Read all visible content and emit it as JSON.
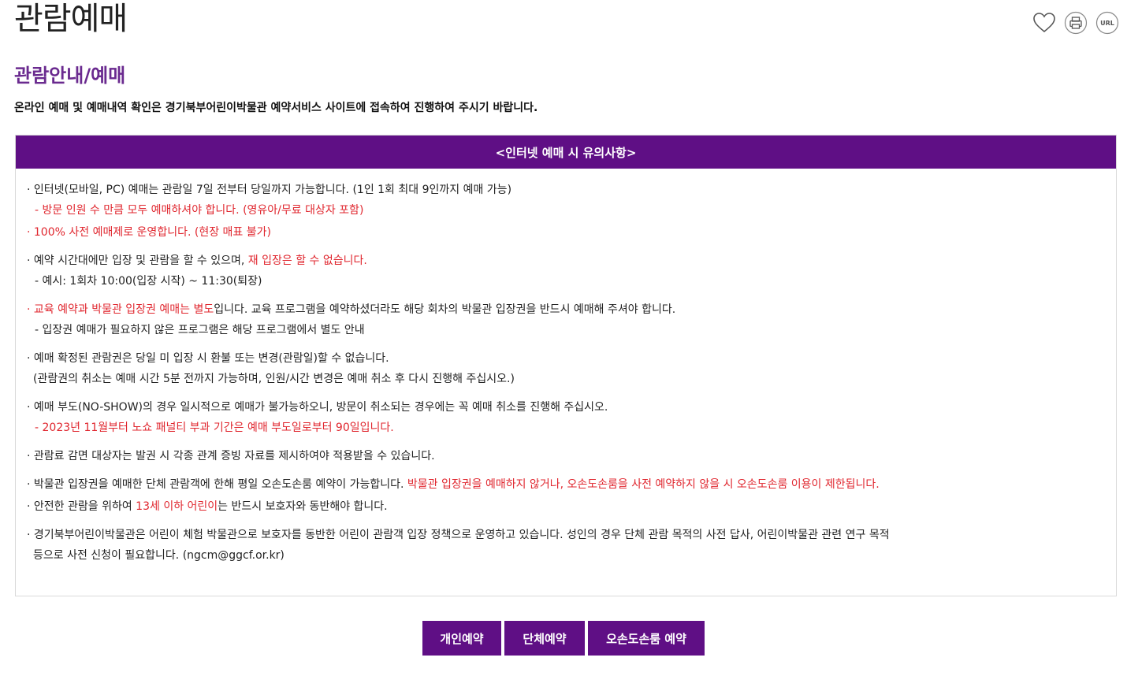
{
  "page": {
    "title": "관람예매"
  },
  "toolbar": {
    "heart_icon": "heart-icon",
    "print_icon": "print-icon",
    "url_label": "URL"
  },
  "section": {
    "title": "관람안내/예매",
    "intro": "온라인 예매 및 예매내역 확인은 경기북부어린이박물관 예약서비스 사이트에 접속하여 진행하여 주시기 바랍니다."
  },
  "notice": {
    "header": "<인터넷 예매 시 유의사항>",
    "item1": {
      "line": "· 인터넷(모바일, PC) 예매는 관람일 7일 전부터 당일까지 가능합니다. (1인 1회 최대 9인까지 예매 가능)",
      "sub_red": "- 방문 인원 수 만큼 모두 예매하셔야 합니다. (영유아/무료 대상자 포함)"
    },
    "item2": {
      "line_red": "· 100% 사전 예매제로 운영합니다. (현장 매표 불가)"
    },
    "item3": {
      "line_a": "· 예약 시간대에만 입장 및 관람을 할 수 있으며, ",
      "line_red": "재 입장은 할 수 없습니다.",
      "sub": "- 예시: 1회차 10:00(입장 시작) ~ 11:30(퇴장)"
    },
    "item4": {
      "line_red": "· 교육 예약과 박물관 입장권 예매는 별도",
      "line_b": "입니다. 교육 프로그램을 예약하셨더라도 해당 회차의 박물관 입장권을 반드시 예매해 주셔야 합니다.",
      "sub": "- 입장권 예매가 필요하지 않은 프로그램은 해당 프로그램에서 별도 안내"
    },
    "item5": {
      "line": "· 예매 확정된 관람권은 당일 미 입장 시 환불 또는 변경(관람일)할 수 없습니다.",
      "cont": "(관람권의 취소는 예매 시간 5분 전까지 가능하며, 인원/시간 변경은 예매 취소 후 다시 진행해 주십시오.)"
    },
    "item6": {
      "line": "· 예매 부도(NO-SHOW)의 경우 일시적으로 예매가 불가능하오니, 방문이 취소되는 경우에는 꼭 예매 취소를 진행해 주십시오.",
      "sub_red": "- 2023년 11월부터 노쇼 패널티 부과 기간은 예매 부도일로부터 90일입니다."
    },
    "item7": {
      "line": "· 관람료 감면 대상자는 발권 시 각종 관계 증빙 자료를 제시하여야 적용받을 수 있습니다."
    },
    "item8": {
      "line_a": "· 박물관 입장권을 예매한 단체 관람객에 한해 평일 오손도손룸 예약이 가능합니다. ",
      "line_red": "박물관 입장권을 예매하지 않거나, 오손도손룸을 사전 예약하지 않을 시 오손도손룸 이용이 제한됩니다."
    },
    "item9": {
      "line_a": "· 안전한 관람을 위하여 ",
      "line_red": "13세 이하 어린이",
      "line_b": "는 반드시 보호자와 동반해야 합니다."
    },
    "item10": {
      "line": "· 경기북부어린이박물관은 어린이 체험 박물관으로 보호자를 동반한 어린이 관람객 입장 정책으로 운영하고 있습니다. 성인의 경우 단체 관람 목적의 사전 답사, 어린이박물관 관련 연구 목적",
      "cont": "등으로 사전 신청이 필요합니다. (ngcm@ggcf.or.kr)"
    }
  },
  "buttons": {
    "individual": "개인예약",
    "group": "단체예약",
    "osondoson": "오손도손룸 예약"
  },
  "colors": {
    "accent": "#5f0f85",
    "section_title": "#6a2a8f",
    "warning": "#e0262e"
  }
}
